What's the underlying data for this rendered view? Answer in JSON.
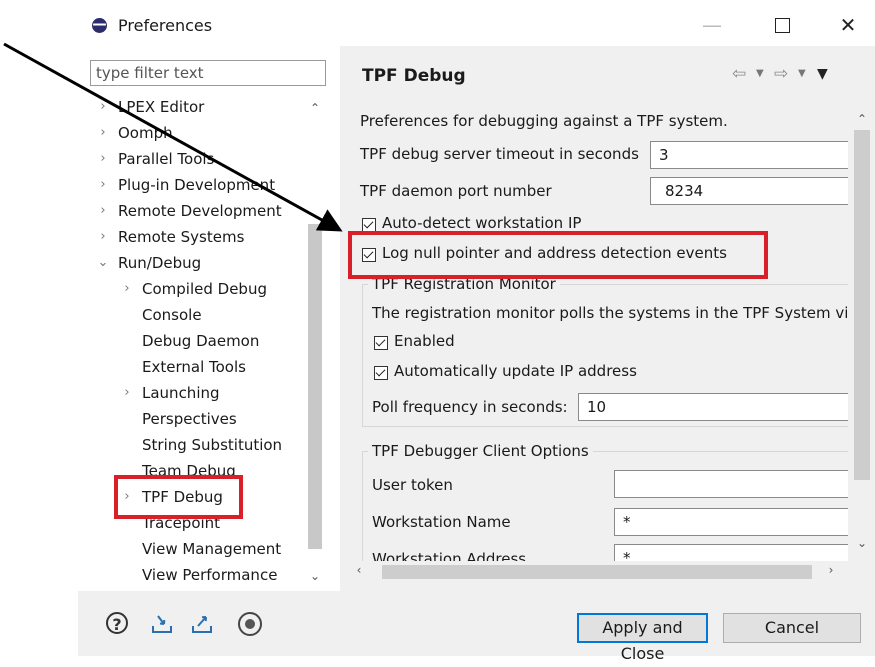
{
  "window": {
    "title": "Preferences",
    "min_glyph": "—",
    "close_glyph": "✕"
  },
  "nav": {
    "filter_placeholder": "type filter text",
    "items": [
      {
        "label": "LPEX Editor",
        "expandable": true,
        "level": 0
      },
      {
        "label": "Oomph",
        "expandable": true,
        "level": 0
      },
      {
        "label": "Parallel Tools",
        "expandable": true,
        "level": 0
      },
      {
        "label": "Plug-in Development",
        "expandable": true,
        "level": 0
      },
      {
        "label": "Remote Development",
        "expandable": true,
        "level": 0
      },
      {
        "label": "Remote Systems",
        "expandable": true,
        "level": 0
      },
      {
        "label": "Run/Debug",
        "expandable": true,
        "expanded": true,
        "level": 0
      },
      {
        "label": "Compiled Debug",
        "expandable": true,
        "level": 1
      },
      {
        "label": "Console",
        "expandable": false,
        "level": 1
      },
      {
        "label": "Debug Daemon",
        "expandable": false,
        "level": 1
      },
      {
        "label": "External Tools",
        "expandable": false,
        "level": 1
      },
      {
        "label": "Launching",
        "expandable": true,
        "level": 1
      },
      {
        "label": "Perspectives",
        "expandable": false,
        "level": 1
      },
      {
        "label": "String Substitution",
        "expandable": false,
        "level": 1
      },
      {
        "label": "Team Debug",
        "expandable": false,
        "level": 1
      },
      {
        "label": "TPF Debug",
        "expandable": true,
        "level": 1,
        "selected": true
      },
      {
        "label": "Tracepoint",
        "expandable": false,
        "level": 1
      },
      {
        "label": "View Management",
        "expandable": false,
        "level": 1
      },
      {
        "label": "View Performance",
        "expandable": false,
        "level": 1
      }
    ]
  },
  "page": {
    "title": "TPF Debug",
    "description": "Preferences for debugging against a TPF system.",
    "timeout_label": "TPF debug server timeout in seconds",
    "timeout_value": "3",
    "port_label": "TPF daemon port number",
    "port_value": "8234",
    "auto_detect_label": "Auto-detect workstation IP",
    "auto_detect_checked": true,
    "log_null_label": "Log null pointer and address detection events",
    "log_null_checked": true,
    "registration": {
      "title": "TPF Registration Monitor",
      "description": "The registration monitor polls the systems in the TPF System vi",
      "enabled_label": "Enabled",
      "enabled_checked": true,
      "auto_update_label": "Automatically update IP address",
      "auto_update_checked": true,
      "poll_label": "Poll frequency in seconds:",
      "poll_value": "10"
    },
    "client_options": {
      "title": "TPF Debugger Client Options",
      "user_token_label": "User token",
      "user_token_value": "",
      "ws_name_label": "Workstation Name",
      "ws_name_value": "*",
      "ws_address_label": "Workstation Address",
      "ws_address_value": "*"
    }
  },
  "buttons": {
    "apply_close": "Apply and Close",
    "cancel": "Cancel"
  },
  "colors": {
    "annotation_red": "#d9202a",
    "default_button_border": "#0078d7"
  }
}
